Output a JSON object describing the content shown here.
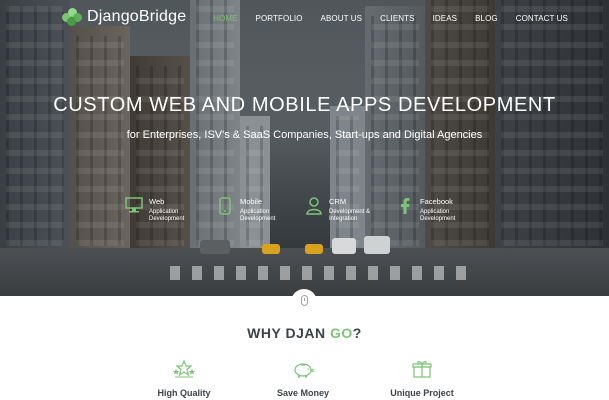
{
  "brand": {
    "name": "DjangoBridge",
    "accent_color": "#7cc576"
  },
  "nav": {
    "items": [
      {
        "label": "HOME",
        "active": true
      },
      {
        "label": "PORTFOLIO",
        "active": false
      },
      {
        "label": "ABOUT US",
        "active": false
      },
      {
        "label": "CLIENTS",
        "active": false
      },
      {
        "label": "IDEAS",
        "active": false
      },
      {
        "label": "BLOG",
        "active": false
      },
      {
        "label": "CONTACT US",
        "active": false
      }
    ]
  },
  "hero": {
    "title": "CUSTOM WEB AND MOBILE APPS DEVELOPMENT",
    "subtitle": "for Enterprises, ISV's & SaaS Companies, Start-ups and Digital Agencies",
    "services": [
      {
        "icon": "monitor-icon",
        "name": "Web",
        "desc": "Application Development"
      },
      {
        "icon": "mobile-icon",
        "name": "Mobile",
        "desc": "Application Development"
      },
      {
        "icon": "user-icon",
        "name": "CRM",
        "desc": "Development & Integration"
      },
      {
        "icon": "facebook-icon",
        "name": "Facebook",
        "desc": "Application Development"
      }
    ]
  },
  "why": {
    "heading_prefix": "WHY DJAN",
    "heading_accent": "GO",
    "heading_suffix": "?",
    "features": [
      {
        "icon": "stars-icon",
        "label": "High Quality"
      },
      {
        "icon": "piggy-bank-icon",
        "label": "Save Money"
      },
      {
        "icon": "gift-icon",
        "label": "Unique Project"
      }
    ]
  }
}
